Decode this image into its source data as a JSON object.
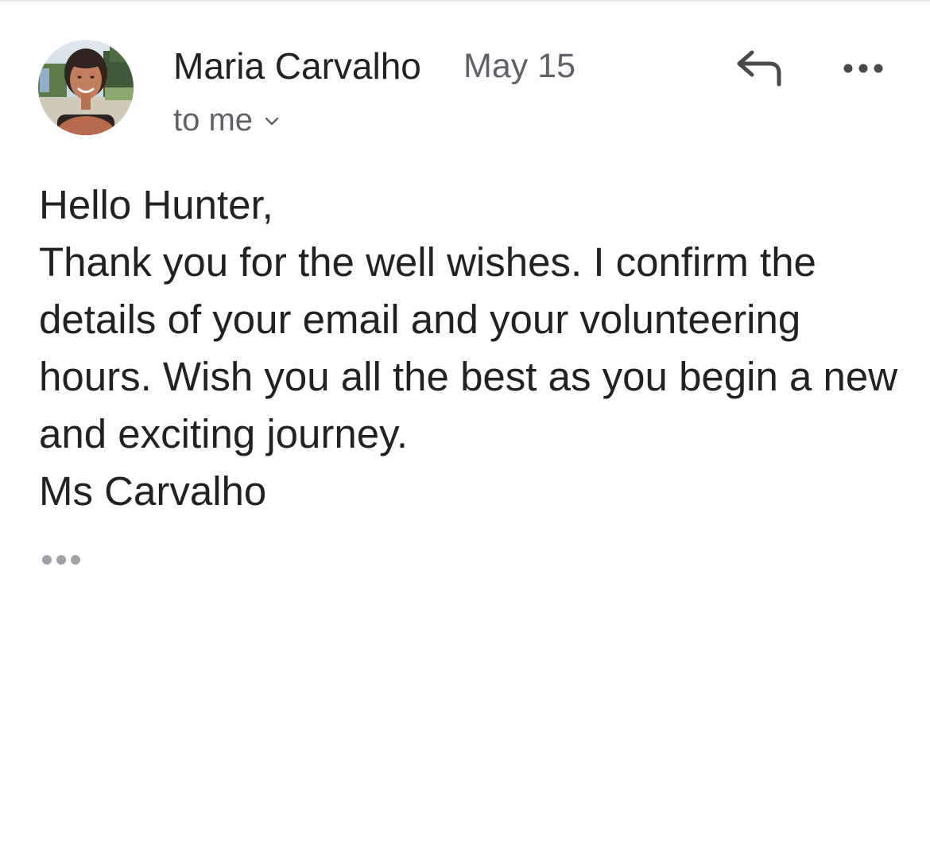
{
  "email": {
    "sender": {
      "name": "Maria Carvalho",
      "avatar_icon": "profile-photo"
    },
    "date": "May 15",
    "recipient_label": "to me",
    "recipient_toggle_icon": "chevron-down-icon",
    "actions": {
      "reply_icon": "reply-icon",
      "more_icon": "more-horizontal-icon"
    },
    "body_lines": [
      "Hello Hunter,",
      "Thank you for the well wishes. I confirm the details of your email and your volunteering hours. Wish you all the best as you begin a new and exciting journey.",
      "Ms Carvalho"
    ],
    "trimmed_content_icon": "ellipsis-icon"
  },
  "colors": {
    "text_primary": "#222222",
    "text_secondary": "#5f6368",
    "icon": "#4a4a4a",
    "trimmed_dots": "#a0a3a8",
    "divider": "#e4e4e4",
    "background": "#ffffff"
  }
}
